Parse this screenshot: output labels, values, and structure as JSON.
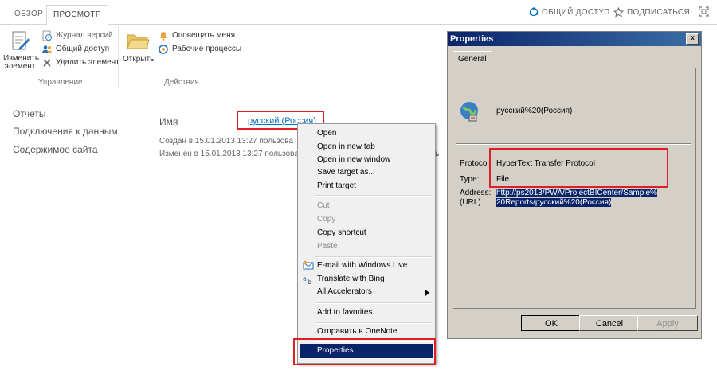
{
  "tabs": {
    "overview": "ОБЗОР",
    "view": "ПРОСМОТР"
  },
  "topbar": {
    "share": "ОБЩИЙ ДОСТУП",
    "follow": "ПОДПИСАТЬСЯ"
  },
  "ribbon": {
    "edit_item_line1": "Изменить",
    "edit_item_line2": "элемент",
    "version_history": "Журнал версий",
    "shared_with": "Общий доступ",
    "delete_item": "Удалить элемент",
    "manage_group": "Управление",
    "open": "Открыть",
    "alert_me": "Оповещать меня",
    "workflows": "Рабочие процессы",
    "actions_group": "Действия"
  },
  "nav": {
    "items": [
      "Отчеты",
      "Подключения к данным",
      "Содержимое сайта"
    ]
  },
  "item": {
    "name_label": "Имя",
    "name_value": "русский (Россия)",
    "created": "Создан в 15.01.2013 13:27  пользова",
    "modified": "Изменен в 15.01.2013 13:27  пользова",
    "trailing_fragment": "ь"
  },
  "context_menu": {
    "open": "Open",
    "open_new_tab": "Open in new tab",
    "open_new_window": "Open in new window",
    "save_target": "Save target as...",
    "print_target": "Print target",
    "cut": "Cut",
    "copy": "Copy",
    "copy_shortcut": "Copy shortcut",
    "paste": "Paste",
    "email_live": "E-mail with Windows Live",
    "translate_bing": "Translate with Bing",
    "all_accelerators": "All Accelerators",
    "add_favorites": "Add to favorites...",
    "send_onenote": "Отправить в OneNote",
    "properties": "Properties"
  },
  "dialog": {
    "title": "Properties",
    "tab_general": "General",
    "item_name": "русский%20(Россия)",
    "protocol_label": "Protocol:",
    "protocol_value": "HyperText Transfer Protocol",
    "type_label": "Type:",
    "type_value": "File",
    "address_label": "Address:",
    "url_label": "(URL)",
    "address_line1": "http://ps2013/PWA/ProjectBICenter/Sample%",
    "address_line2": "20Reports/русский%20(Россия)",
    "ok": "OK",
    "cancel": "Cancel",
    "apply": "Apply"
  },
  "colors": {
    "highlight_red": "#e01e26",
    "selection_blue": "#0a246a",
    "dialog_gray": "#d4d0c8"
  }
}
